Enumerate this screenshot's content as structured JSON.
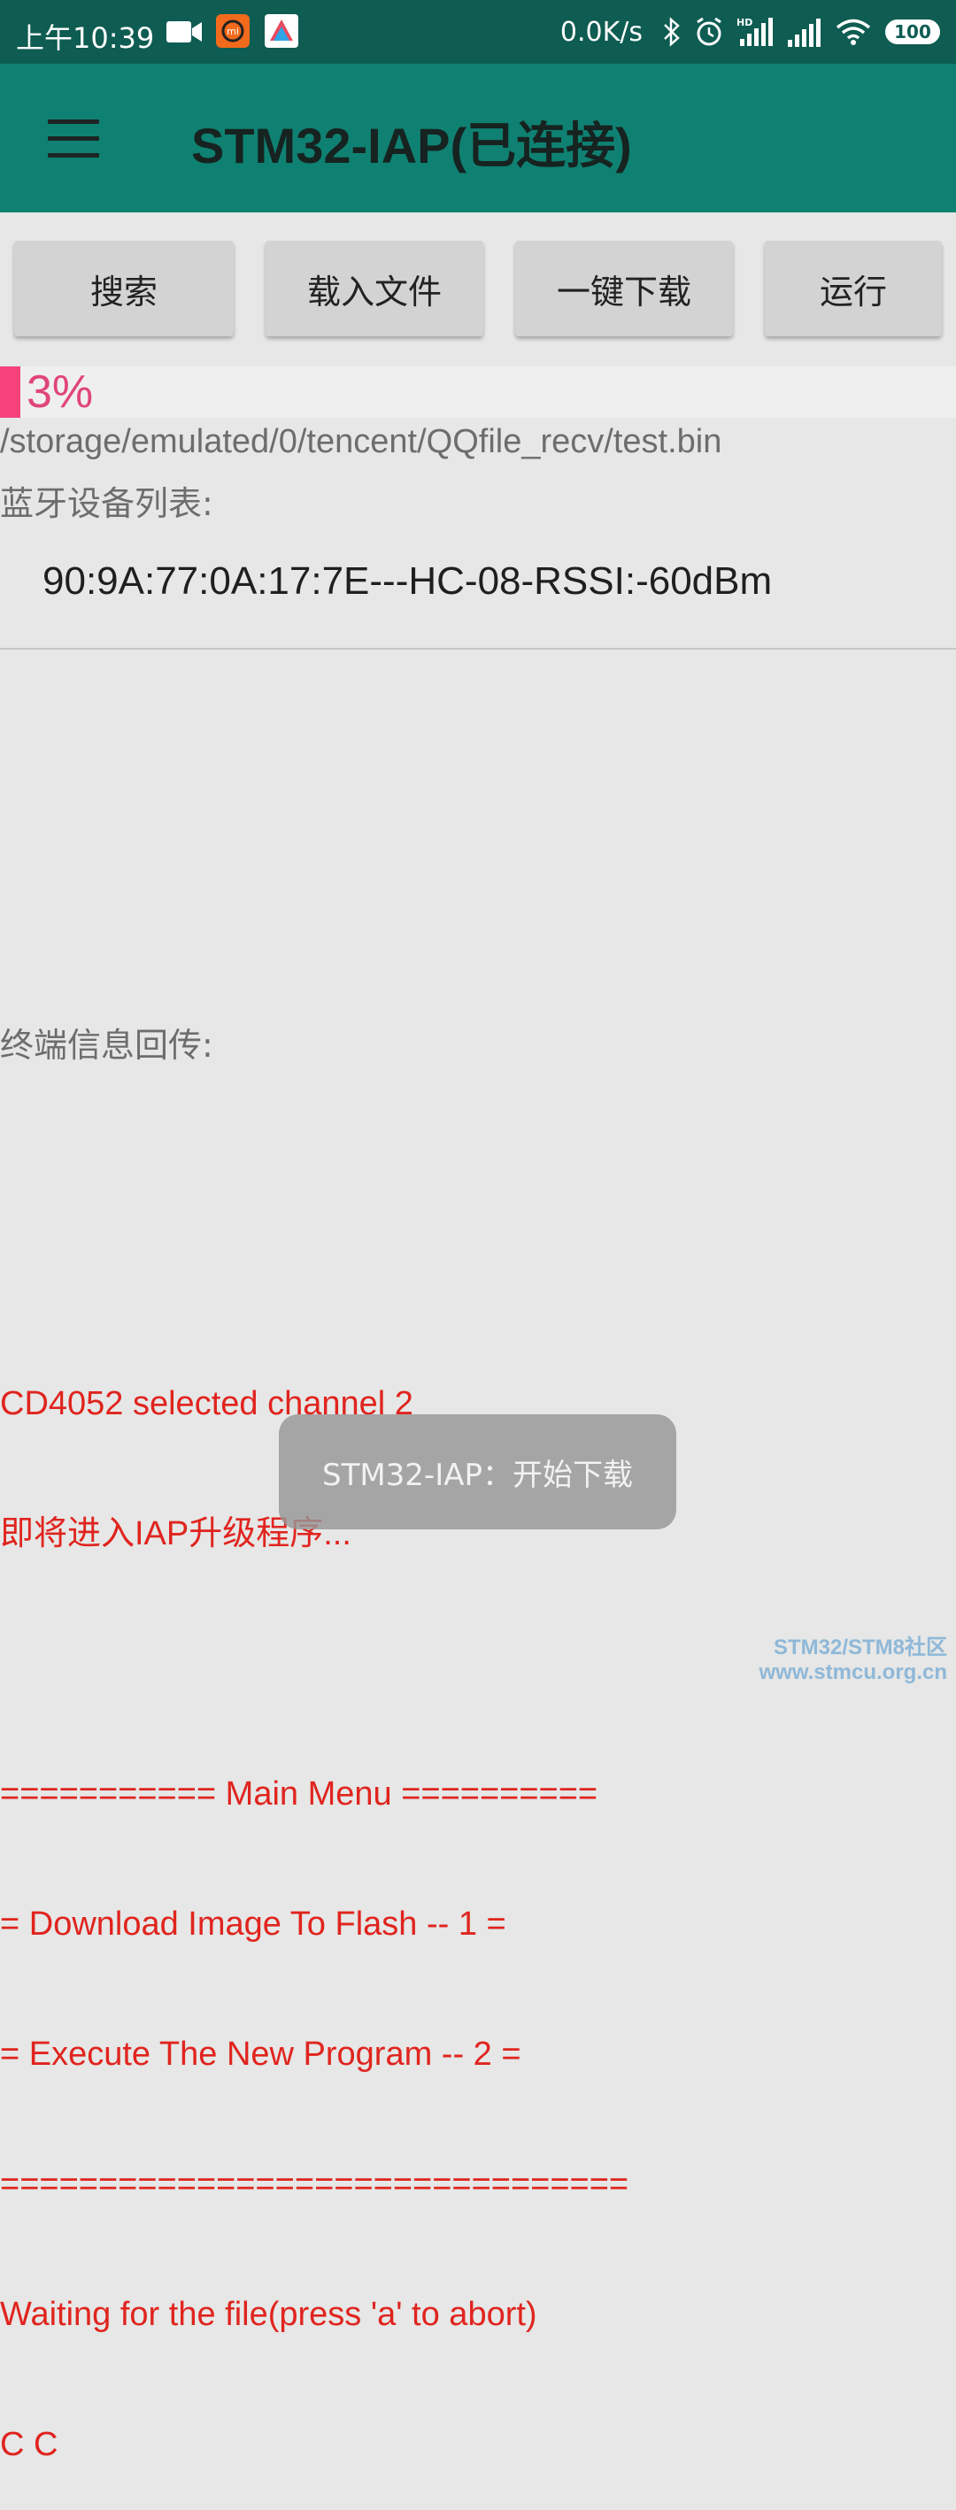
{
  "status_bar": {
    "time": "上午10:39",
    "network_speed": "0.0K/s",
    "battery": "100",
    "icons": [
      "video-icon",
      "mi-app-icon",
      "app-icon",
      "bluetooth-icon",
      "alarm-icon",
      "hd-signal-icon",
      "signal-icon",
      "wifi-icon",
      "battery-icon"
    ]
  },
  "toolbar": {
    "title": "STM32-IAP(已连接)"
  },
  "buttons": {
    "search": "搜索",
    "load_file": "载入文件",
    "one_key_download": "一键下载",
    "run": "运行"
  },
  "progress": {
    "percent": 3,
    "label": "3%"
  },
  "file_path": "/storage/emulated/0/tencent/QQfile_recv/test.bin",
  "device_section": {
    "label": "蓝牙设备列表:",
    "items": [
      "90:9A:77:0A:17:7E---HC-08-RSSI:-60dBm"
    ]
  },
  "terminal": {
    "label": "终端信息回传:",
    "lines": [
      "CD4052 selected channel 2",
      "即将进入IAP升级程序...",
      "",
      "=========== Main Menu ==========",
      "= Download Image To Flash -- 1 =",
      "= Execute The New Program -- 2 =",
      "================================",
      "Waiting for the file(press 'a' to abort)",
      "C C"
    ]
  },
  "toast": "STM32-IAP：开始下载",
  "watermark": {
    "line1": "STM32/STM8社区",
    "line2": "www.stmcu.org.cn"
  },
  "colors": {
    "status_bar": "#0e5c52",
    "toolbar": "#0f8172",
    "accent_progress": "#f5427b",
    "terminal_text": "#e0241e"
  }
}
